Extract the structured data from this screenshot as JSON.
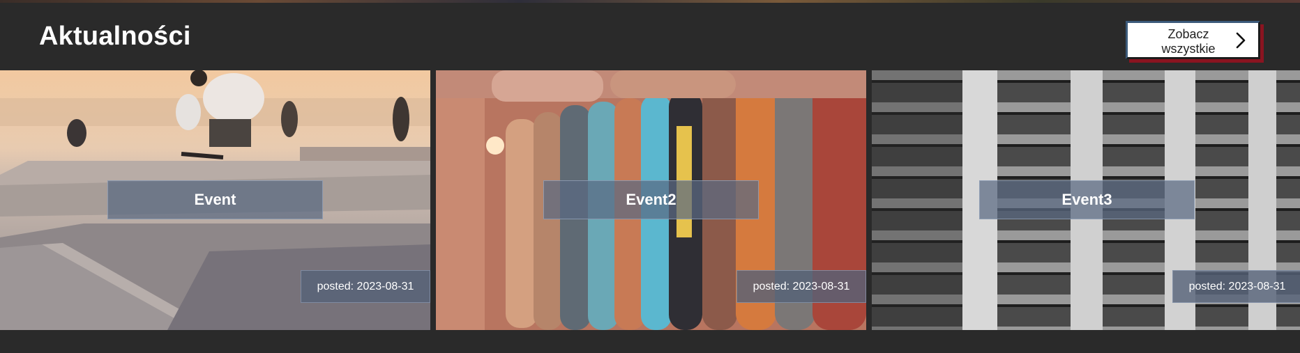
{
  "header": {
    "title": "Aktualności",
    "see_all_label": "Zobacz\nwszystkie",
    "see_all_icon": "chevron-right-icon"
  },
  "events": [
    {
      "title": "Event",
      "posted": "posted: 2023-08-31",
      "photo": "skatepark-jump-photo"
    },
    {
      "title": "Event2",
      "posted": "posted: 2023-08-31",
      "photo": "skateboard-decks-wall-photo"
    },
    {
      "title": "Event3",
      "posted": "posted: 2023-08-31",
      "photo": "apartment-building-facade-photo"
    }
  ],
  "colors": {
    "background": "#2a2a2a",
    "button_shadow": "#8a1420",
    "title_box": "#5a6982",
    "badge": "#556278"
  }
}
